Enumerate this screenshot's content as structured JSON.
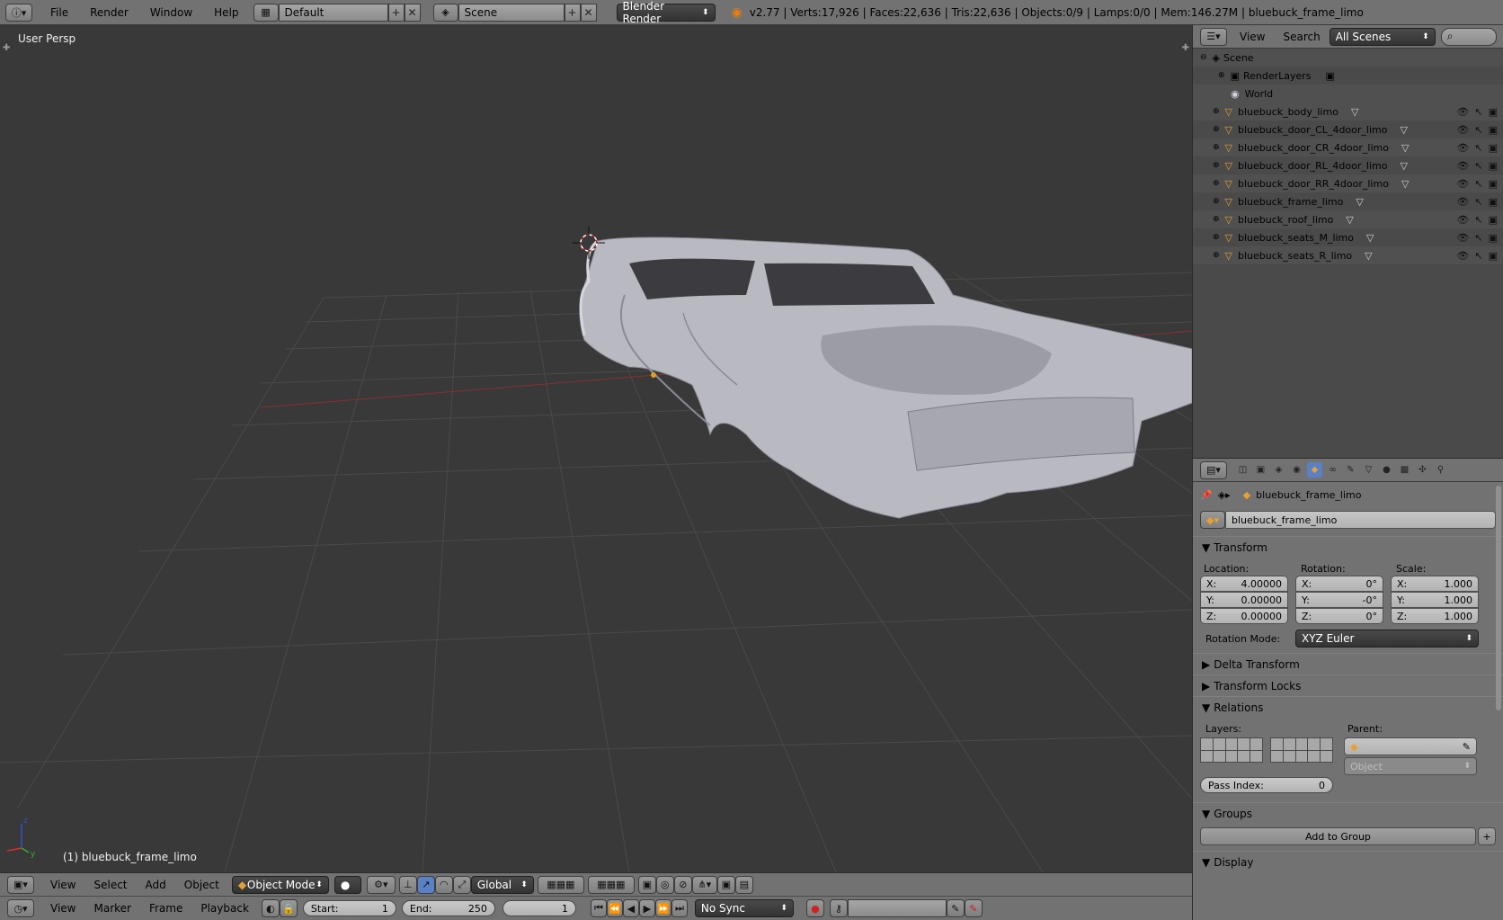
{
  "topbar": {
    "menus": [
      "File",
      "Render",
      "Window",
      "Help"
    ],
    "layout": "Default",
    "scene": "Scene",
    "engine": "Blender Render",
    "stats": "v2.77 | Verts:17,926 | Faces:22,636 | Tris:22,636 | Objects:0/9 | Lamps:0/0 | Mem:146.27M | bluebuck_frame_limo"
  },
  "viewport": {
    "view_name": "User Persp",
    "active_object_label": "(1) bluebuck_frame_limo"
  },
  "view3d_header": {
    "menus": [
      "View",
      "Select",
      "Add",
      "Object"
    ],
    "mode": "Object Mode",
    "orientation": "Global"
  },
  "timeline": {
    "menus": [
      "View",
      "Marker",
      "Frame",
      "Playback"
    ],
    "start_label": "Start:",
    "start_value": "1",
    "end_label": "End:",
    "end_value": "250",
    "current_frame": "1",
    "sync": "No Sync"
  },
  "outliner": {
    "menus": [
      "View",
      "Search"
    ],
    "display_mode": "All Scenes",
    "scene": "Scene",
    "render_layers": "RenderLayers",
    "world": "World",
    "objects": [
      "bluebuck_body_limo",
      "bluebuck_door_CL_4door_limo",
      "bluebuck_door_CR_4door_limo",
      "bluebuck_door_RL_4door_limo",
      "bluebuck_door_RR_4door_limo",
      "bluebuck_frame_limo",
      "bluebuck_roof_limo",
      "bluebuck_seats_M_limo",
      "bluebuck_seats_R_limo"
    ]
  },
  "properties": {
    "breadcrumb": "bluebuck_frame_limo",
    "object_name": "bluebuck_frame_limo",
    "transform": {
      "title": "Transform",
      "location_label": "Location:",
      "rotation_label": "Rotation:",
      "scale_label": "Scale:",
      "loc": {
        "x": "4.00000",
        "y": "0.00000",
        "z": "0.00000"
      },
      "rot": {
        "x": "0°",
        "y": "-0°",
        "z": "0°"
      },
      "scale": {
        "x": "1.000",
        "y": "1.000",
        "z": "1.000"
      },
      "rotation_mode_label": "Rotation Mode:",
      "rotation_mode": "XYZ Euler"
    },
    "delta_transform": "Delta Transform",
    "transform_locks": "Transform Locks",
    "relations": {
      "title": "Relations",
      "layers_label": "Layers:",
      "parent_label": "Parent:",
      "parent_type_placeholder": "Object",
      "pass_index_label": "Pass Index:",
      "pass_index": "0"
    },
    "groups": {
      "title": "Groups",
      "add_button": "Add to Group"
    },
    "display": "Display"
  }
}
